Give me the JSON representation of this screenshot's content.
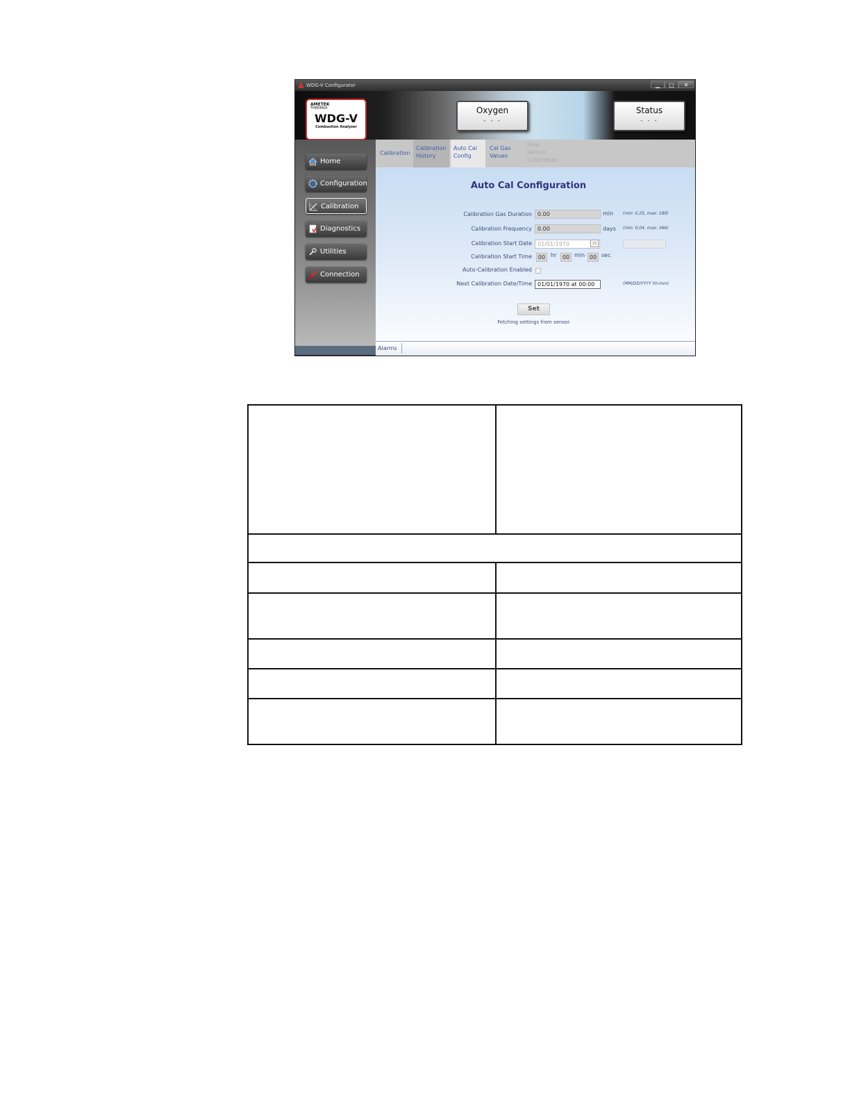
{
  "window": {
    "title": "WDG-V Configurator",
    "controls": {
      "minimize": "▁",
      "maximize": "□",
      "close": "✕"
    }
  },
  "logo": {
    "brand": "AMETEK",
    "sub_brand": "THERMOX",
    "product": "WDG-V",
    "tagline": "Combustion Analyzer"
  },
  "readouts": {
    "oxygen": {
      "label": "Oxygen",
      "value": "- - -"
    },
    "status": {
      "label": "Status",
      "value": "- - -"
    }
  },
  "sidebar": {
    "items": [
      {
        "label": "Home",
        "icon": "home-icon"
      },
      {
        "label": "Configuration",
        "icon": "gear-icon"
      },
      {
        "label": "Calibration",
        "icon": "calibration-icon",
        "active": true
      },
      {
        "label": "Diagnostics",
        "icon": "diagnostics-icon"
      },
      {
        "label": "Utilities",
        "icon": "wrench-icon"
      },
      {
        "label": "Connection",
        "icon": "connection-icon"
      }
    ]
  },
  "tabs": [
    {
      "label": "Calibration"
    },
    {
      "label": "Calibration\nHistory"
    },
    {
      "label": "Auto Cal\nConfig",
      "active": true
    },
    {
      "label": "Cal Gas\nValues"
    },
    {
      "label": "Flow\nSensor\nCalibration",
      "disabled": true
    }
  ],
  "form": {
    "title": "Auto Cal Configuration",
    "gas_duration": {
      "label": "Calibration Gas Duration",
      "value": "0.00",
      "unit": "min",
      "hint": "(min: 0.25, max: 180)"
    },
    "frequency": {
      "label": "Calibration Frequency",
      "value": "0.00",
      "unit": "days",
      "hint": "(min: 0.04, max: 366)"
    },
    "start_date": {
      "label": "Calibration Start Date",
      "value": "01/01/1970",
      "picker": "15"
    },
    "start_time": {
      "label": "Calibration Start Time",
      "hr": "00",
      "hr_unit": "hr",
      "min": "00",
      "min_unit": "min",
      "sec": "00",
      "sec_unit": "sec"
    },
    "enabled": {
      "label": "Auto-Calibration Enabled",
      "checked": false
    },
    "next": {
      "label": "Next Calibration Date/Time",
      "value": "01/01/1970 at 00:00",
      "hint": "(MM/DD/YYYY hh:mm)"
    },
    "set_button": "Set",
    "status": "Fetching settings from sensor."
  },
  "statusbar": {
    "alarms": "Alarms"
  },
  "colors": {
    "accent_text": "#33337a",
    "logo_border": "#c62828",
    "tab_text": "#3a5aa8"
  }
}
